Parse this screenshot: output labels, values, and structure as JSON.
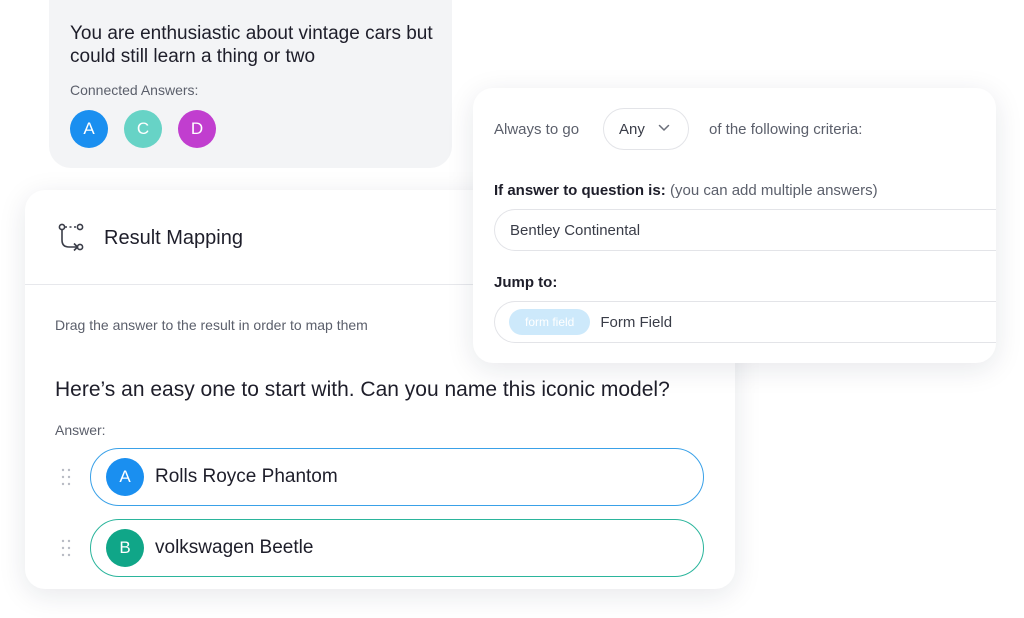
{
  "result_card": {
    "title": "You are enthusiastic about vintage cars but could still learn a thing or two",
    "connected_label": "Connected Answers:",
    "badges": [
      {
        "letter": "A",
        "color": "#1a8ff0"
      },
      {
        "letter": "C",
        "color": "#67d3c6"
      },
      {
        "letter": "D",
        "color": "#c13ecf"
      }
    ]
  },
  "mapping": {
    "title": "Result Mapping",
    "icon": "route-icon",
    "help_text": "Drag the answer to the result in order to map them",
    "question": "Here’s an easy one to start with. Can you name this iconic model?",
    "answer_label": "Answer:",
    "answers": [
      {
        "letter": "A",
        "text": "Rolls Royce Phantom",
        "color": "#1a8ff0",
        "border": "#3aa1e8"
      },
      {
        "letter": "B",
        "text": "volkswagen Beetle",
        "color": "#10a688",
        "border": "#2bb59c"
      }
    ]
  },
  "logic": {
    "always_label": "Always to go",
    "any_value": "Any",
    "criteria_label": "of the following criteria:",
    "if_label": "If answer to question is:",
    "if_hint": "(you can add multiple answers)",
    "answer_value": "Bentley Continental",
    "jump_label": "Jump to:",
    "chip_label": "form field",
    "jump_value": "Form Field"
  }
}
